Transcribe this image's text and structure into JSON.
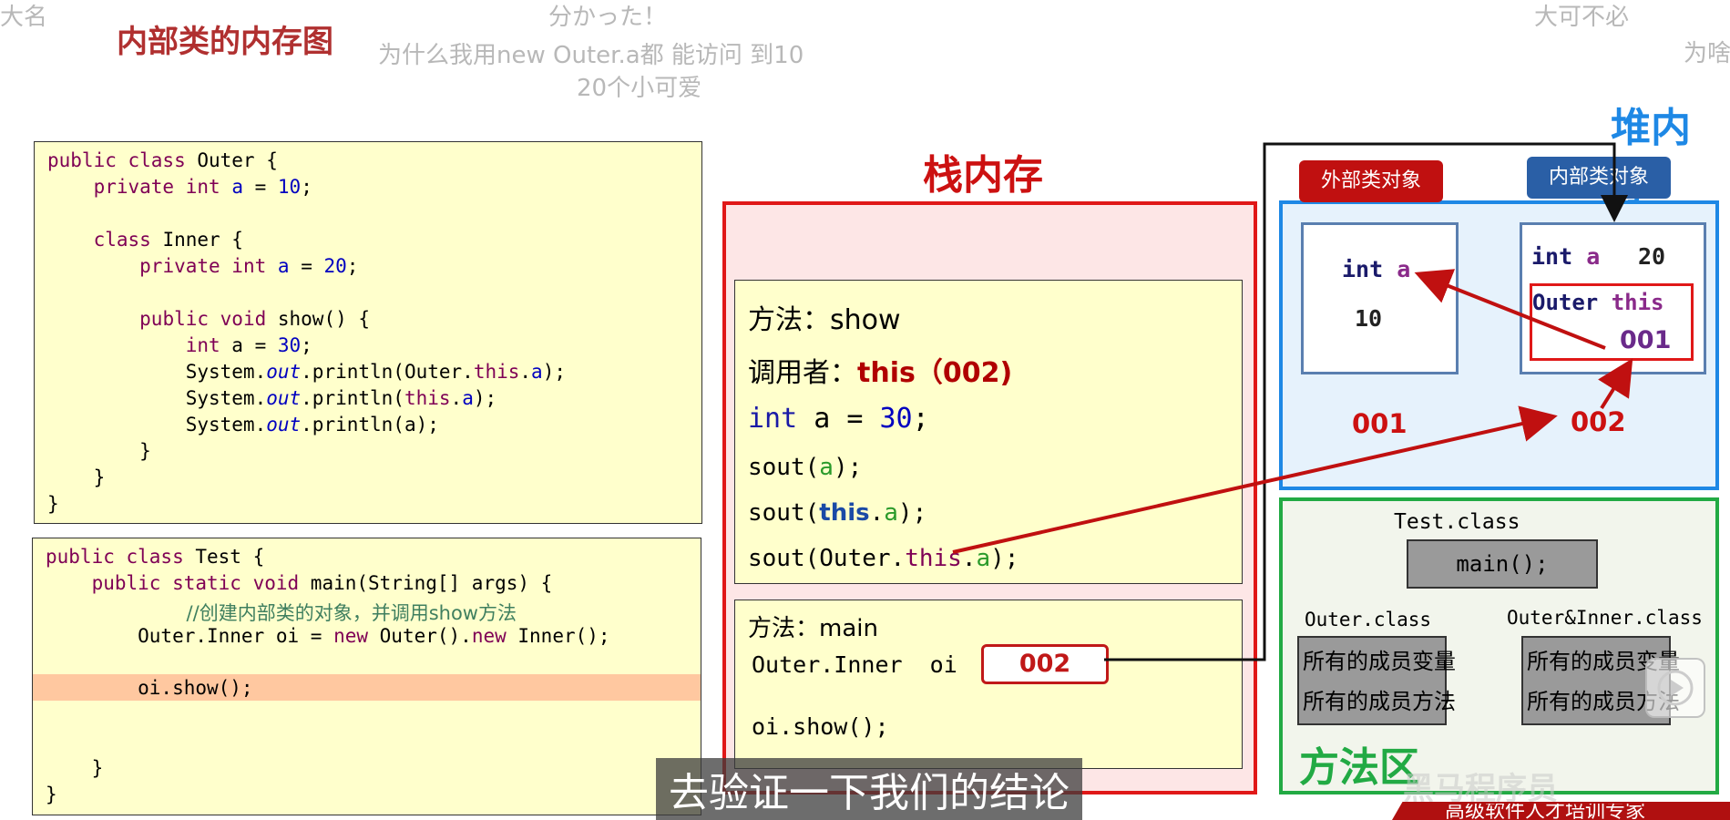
{
  "slide_title": "内部类的内存图",
  "danmaku": [
    "大名",
    "分かった！",
    "为什么我用new Outer.a都 能访问 到10",
    "20个小可爱",
    "大可不必",
    "为啥"
  ],
  "code_outer": [
    "public class Outer {",
    "    private int a = 10;",
    "",
    "    class Inner {",
    "        private int a = 20;",
    "",
    "        public void show() {",
    "            int a = 30;",
    "            System.out.println(Outer.this.a);",
    "            System.out.println(this.a);",
    "            System.out.println(a);",
    "        }",
    "    }",
    "}"
  ],
  "code_test": [
    "public class Test {",
    "    public static void main(String[] args) {",
    "        //创建内部类的对象，并调用show方法",
    "        Outer.Inner oi = new Outer().new Inner();",
    "",
    "        oi.show();",
    "",
    "",
    "    }",
    "}"
  ],
  "stack": {
    "label": "栈内存",
    "show_frame": {
      "method": "方法：show",
      "caller_label": "调用者：",
      "caller_value": "this（002)",
      "local_var": "int a = 30;",
      "sout1": "sout(a);",
      "sout2": "sout(this.a);",
      "sout3": "sout(Outer.this.a);"
    },
    "main_frame": {
      "method": "方法：main",
      "var_decl": "Outer.Inner  oi",
      "var_value": "002",
      "call": "oi.show();"
    }
  },
  "heap": {
    "label": "堆内存",
    "outer_badge": "外部类对象",
    "inner_badge": "内部类对象",
    "outer_obj": {
      "field": "int a",
      "value": "10",
      "address": "001"
    },
    "inner_obj": {
      "field": "int a",
      "value": "20",
      "outer_ref": "Outer this",
      "outer_ref_value": "001",
      "address": "002"
    }
  },
  "method_area": {
    "label": "方法区",
    "test_class": "Test.class",
    "main_method": "main();",
    "outer_class": "Outer.class",
    "outer_vars": "所有的成员变量",
    "outer_methods": "所有的成员方法",
    "inner_class": "Outer&Inner.class",
    "inner_vars": "所有的成员变量",
    "inner_methods": "所有的成员方法"
  },
  "subtitle": "去验证一下我们的结论",
  "watermark": "黑马程序员",
  "footer_banner": "高级软件人才培训专家",
  "colors": {
    "accent_red": "#cc1111",
    "heap_blue": "#1e88e5",
    "method_green": "#22aa44",
    "code_bg": "#ffffcc"
  }
}
